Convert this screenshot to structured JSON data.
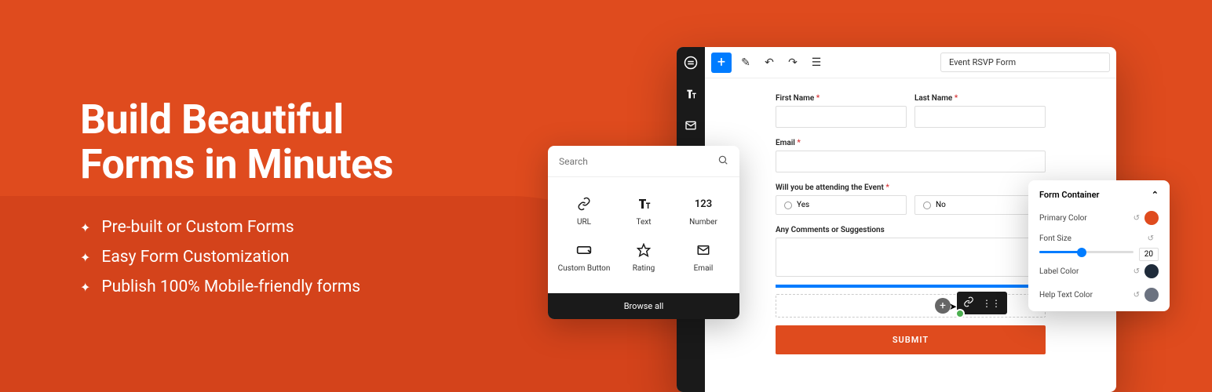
{
  "headline_line1": "Build Beautiful",
  "headline_line2": "Forms in Minutes",
  "features": [
    "Pre-built or Custom Forms",
    "Easy Form Customization",
    "Publish 100% Mobile-friendly forms"
  ],
  "editor": {
    "form_title": "Event RSVP Form",
    "fields": {
      "first_name": "First Name",
      "last_name": "Last Name",
      "email": "Email",
      "attending": "Will you be attending the Event",
      "yes": "Yes",
      "no": "No",
      "comments": "Any Comments or Suggestions"
    },
    "submit": "SUBMIT"
  },
  "picker": {
    "search_placeholder": "Search",
    "items": [
      {
        "label": "URL",
        "icon": "link"
      },
      {
        "label": "Text",
        "icon": "text"
      },
      {
        "label": "Number",
        "icon": "123"
      },
      {
        "label": "Custom Button",
        "icon": "button"
      },
      {
        "label": "Rating",
        "icon": "star"
      },
      {
        "label": "Email",
        "icon": "mail"
      }
    ],
    "browse_all": "Browse all"
  },
  "settings": {
    "title": "Form Container",
    "primary_color_label": "Primary Color",
    "primary_color": "#DF4B1E",
    "font_size_label": "Font Size",
    "font_size_value": "20",
    "label_color_label": "Label Color",
    "label_color": "#1f2b3a",
    "help_text_color_label": "Help Text Color",
    "help_text_color": "#6b7280"
  }
}
